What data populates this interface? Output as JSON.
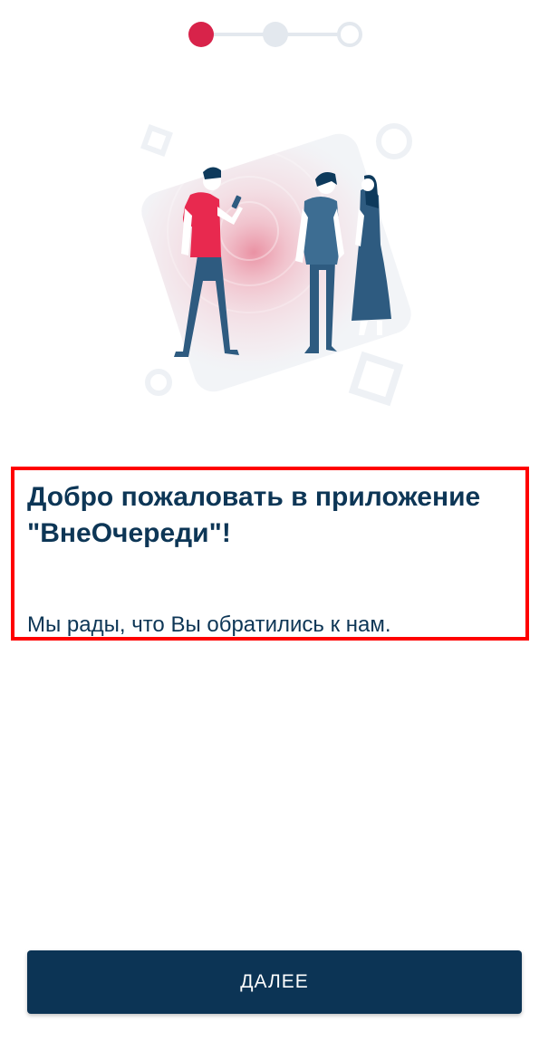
{
  "onboarding": {
    "step_current": 1,
    "step_total": 3,
    "title": "Добро пожаловать в приложение \"ВнеОчереди\"!",
    "subtitle": "Мы рады, что Вы обратились к нам.",
    "next_label": "ДАЛЕЕ"
  },
  "colors": {
    "accent": "#d8234a",
    "primary": "#0c3455",
    "inactive": "#e3e8ee"
  },
  "icons": {
    "illustration": "people-queue-illustration"
  }
}
